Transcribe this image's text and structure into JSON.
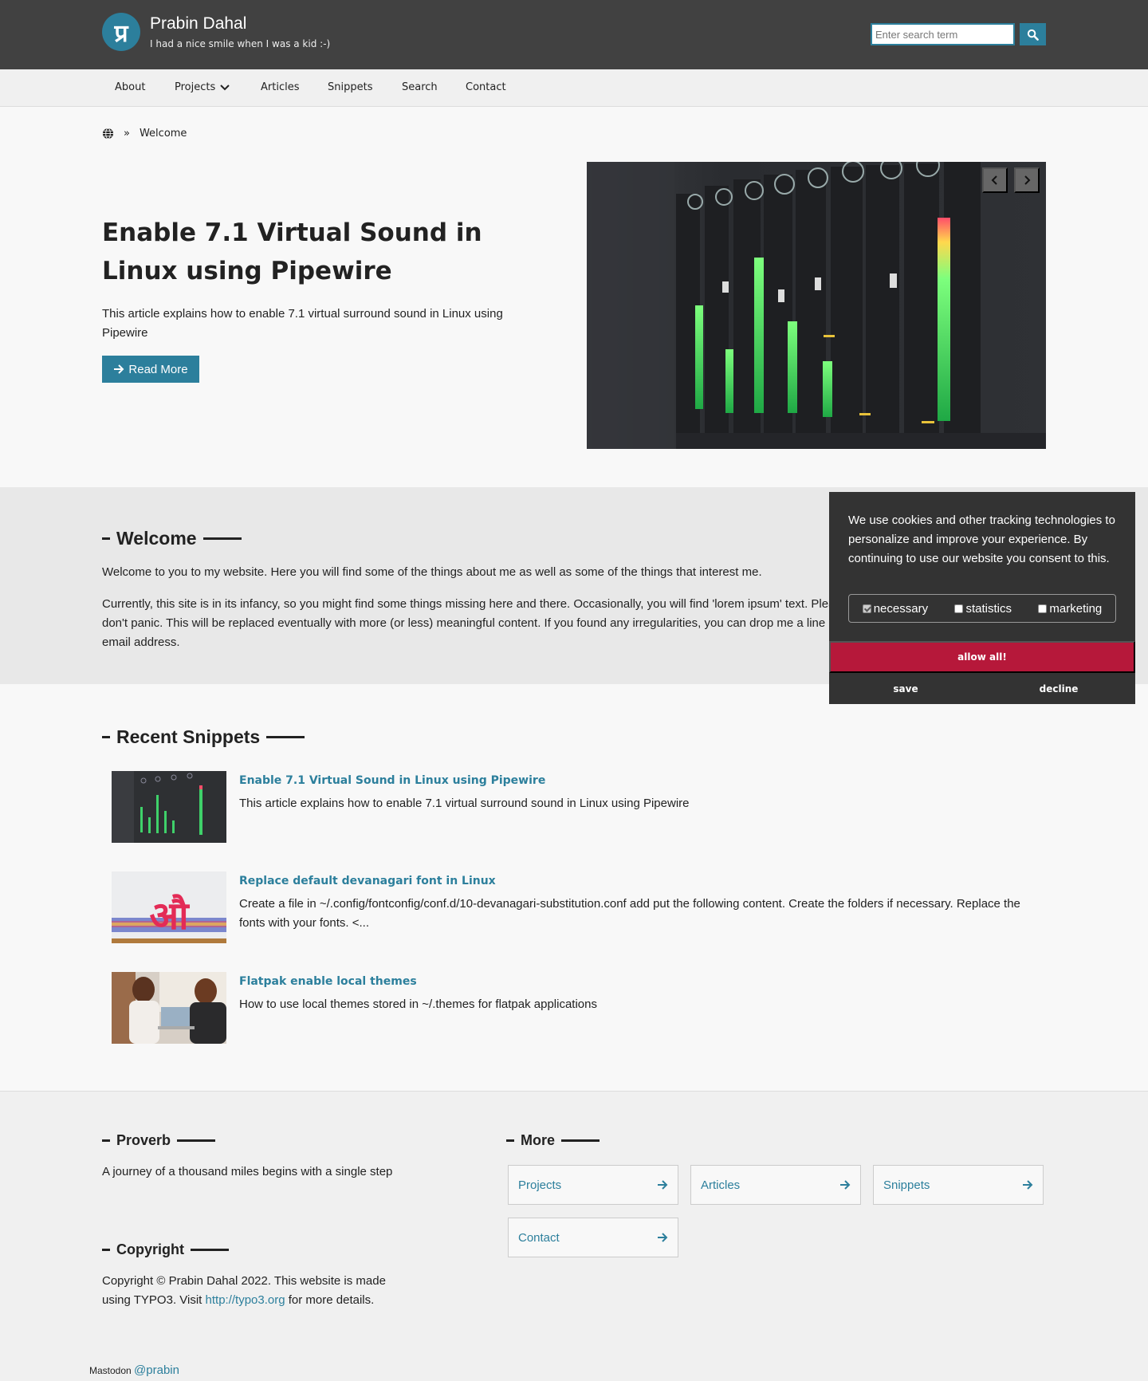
{
  "header": {
    "logo_glyph": "प्र",
    "site_name": "Prabin Dahal",
    "tagline": "I had a nice smile when I was a kid :-)",
    "search_placeholder": "Enter search term"
  },
  "nav": {
    "items": [
      "About",
      "Projects",
      "Articles",
      "Snippets",
      "Search",
      "Contact"
    ]
  },
  "breadcrumb": {
    "separator": "»",
    "current": "Welcome"
  },
  "hero": {
    "title": "Enable 7.1 Virtual Sound in Linux using Pipewire",
    "description": "This article explains how to enable 7.1 virtual surround sound in Linux using Pipewire",
    "button_label": "Read More"
  },
  "welcome": {
    "heading": "Welcome",
    "paragraph1": "Welcome to you to my website. Here you will find some of the things about me as well as some of the things that interest me.",
    "paragraph2": "Currently, this site is in its infancy, so you might find some things missing here and there. Occasionally, you will find 'lorem ipsum' text. Please don't panic. This will be replaced eventually with more (or less) meaningful content.  If you found any irregularities, you can drop me a line at my email address."
  },
  "snippets": {
    "heading": "Recent Snippets",
    "items": [
      {
        "title": "Enable 7.1 Virtual Sound in Linux using Pipewire",
        "text": "This article explains how to enable 7.1 virtual surround sound in Linux using Pipewire"
      },
      {
        "title": "Replace default devanagari font in Linux",
        "text": "Create a file in ~/.config/fontconfig/conf.d/10-devanagari-substitution.conf add put the following content. Create the folders if necessary. Replace the fonts with your fonts. <..."
      },
      {
        "title": "Flatpak enable local themes",
        "text": "How to use local themes stored in ~/.themes for flatpak applications"
      }
    ]
  },
  "footer": {
    "proverb_heading": "Proverb",
    "proverb_text": "A journey of a thousand miles begins with a single step",
    "copyright_heading": "Copyright",
    "copyright_text_before": "Copyright © Prabin Dahal 2022. This website is made using TYPO3. Visit ",
    "copyright_link": "http://typo3.org",
    "copyright_text_after": " for more details.",
    "more_heading": "More",
    "more_links": [
      "Projects",
      "Articles",
      "Snippets",
      "Contact"
    ],
    "mastodon_label": "Mastodon",
    "mastodon_handle": "@prabin"
  },
  "cookie": {
    "text": "We use cookies and other tracking technologies to personalize and improve your experience. By continuing to use our website you consent to this.",
    "options": [
      {
        "label": "necessary",
        "checked": true
      },
      {
        "label": "statistics",
        "checked": false
      },
      {
        "label": "marketing",
        "checked": false
      }
    ],
    "allow_all": "allow all!",
    "save": "save",
    "decline": "decline"
  },
  "colors": {
    "accent": "#2c7f9c",
    "header_bg": "#414141",
    "cookie_bg": "#333333",
    "allow_all_bg": "#b6183a"
  }
}
